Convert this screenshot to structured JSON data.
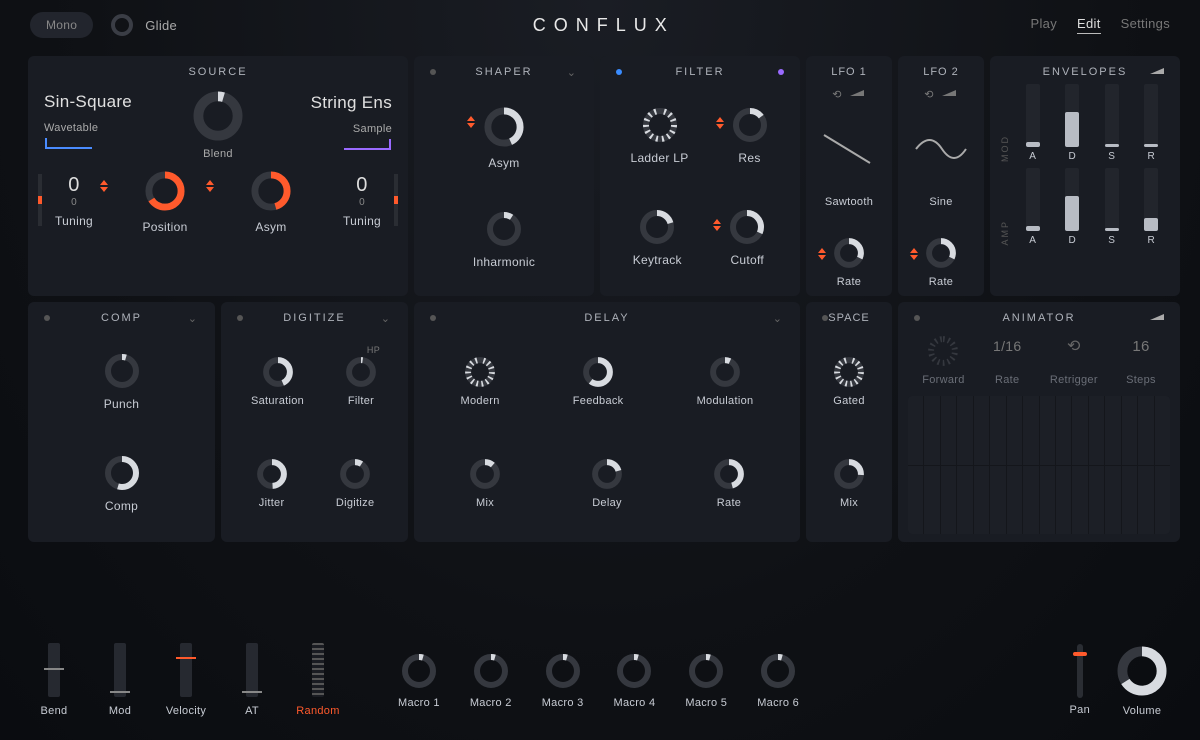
{
  "app_name": "CONFLUX",
  "header": {
    "mono": "Mono",
    "glide": "Glide",
    "nav": {
      "play": "Play",
      "edit": "Edit",
      "settings": "Settings"
    }
  },
  "source": {
    "title": "SOURCE",
    "osc_a_name": "Sin-Square",
    "osc_a_type": "Wavetable",
    "osc_b_name": "String Ens",
    "osc_b_type": "Sample",
    "blend_label": "Blend",
    "tuning_label": "Tuning",
    "tuning_a_semi": "0",
    "tuning_a_fine": "0",
    "tuning_b_semi": "0",
    "tuning_b_fine": "0",
    "position_label": "Position",
    "asym_label": "Asym"
  },
  "shaper": {
    "title": "SHAPER",
    "asym": "Asym",
    "inharmonic": "Inharmonic"
  },
  "filter": {
    "title": "FILTER",
    "type": "Ladder LP",
    "res": "Res",
    "keytrack": "Keytrack",
    "cutoff": "Cutoff"
  },
  "lfo1": {
    "title": "LFO 1",
    "shape": "Sawtooth",
    "rate": "Rate"
  },
  "lfo2": {
    "title": "LFO 2",
    "shape": "Sine",
    "rate": "Rate"
  },
  "envelopes": {
    "title": "ENVELOPES",
    "mod_label": "MOD",
    "amp_label": "AMP",
    "a": "A",
    "d": "D",
    "s": "S",
    "r": "R"
  },
  "comp": {
    "title": "COMP",
    "punch": "Punch",
    "comp": "Comp"
  },
  "digitize": {
    "title": "DIGITIZE",
    "saturation": "Saturation",
    "filter": "Filter",
    "hp": "HP",
    "jitter": "Jitter",
    "digitize": "Digitize"
  },
  "delay": {
    "title": "DELAY",
    "modern": "Modern",
    "feedback": "Feedback",
    "modulation": "Modulation",
    "mix": "Mix",
    "delay": "Delay",
    "rate": "Rate"
  },
  "space": {
    "title": "SPACE",
    "gated": "Gated",
    "mix": "Mix"
  },
  "animator": {
    "title": "ANIMATOR",
    "forward": "Forward",
    "rate_label": "Rate",
    "rate_val": "1/16",
    "retrigger": "Retrigger",
    "steps_label": "Steps",
    "steps_val": "16"
  },
  "footer": {
    "bend": "Bend",
    "mod": "Mod",
    "velocity": "Velocity",
    "at": "AT",
    "random": "Random",
    "macros": [
      "Macro 1",
      "Macro 2",
      "Macro 3",
      "Macro 4",
      "Macro 5",
      "Macro 6"
    ],
    "pan": "Pan",
    "volume": "Volume"
  }
}
